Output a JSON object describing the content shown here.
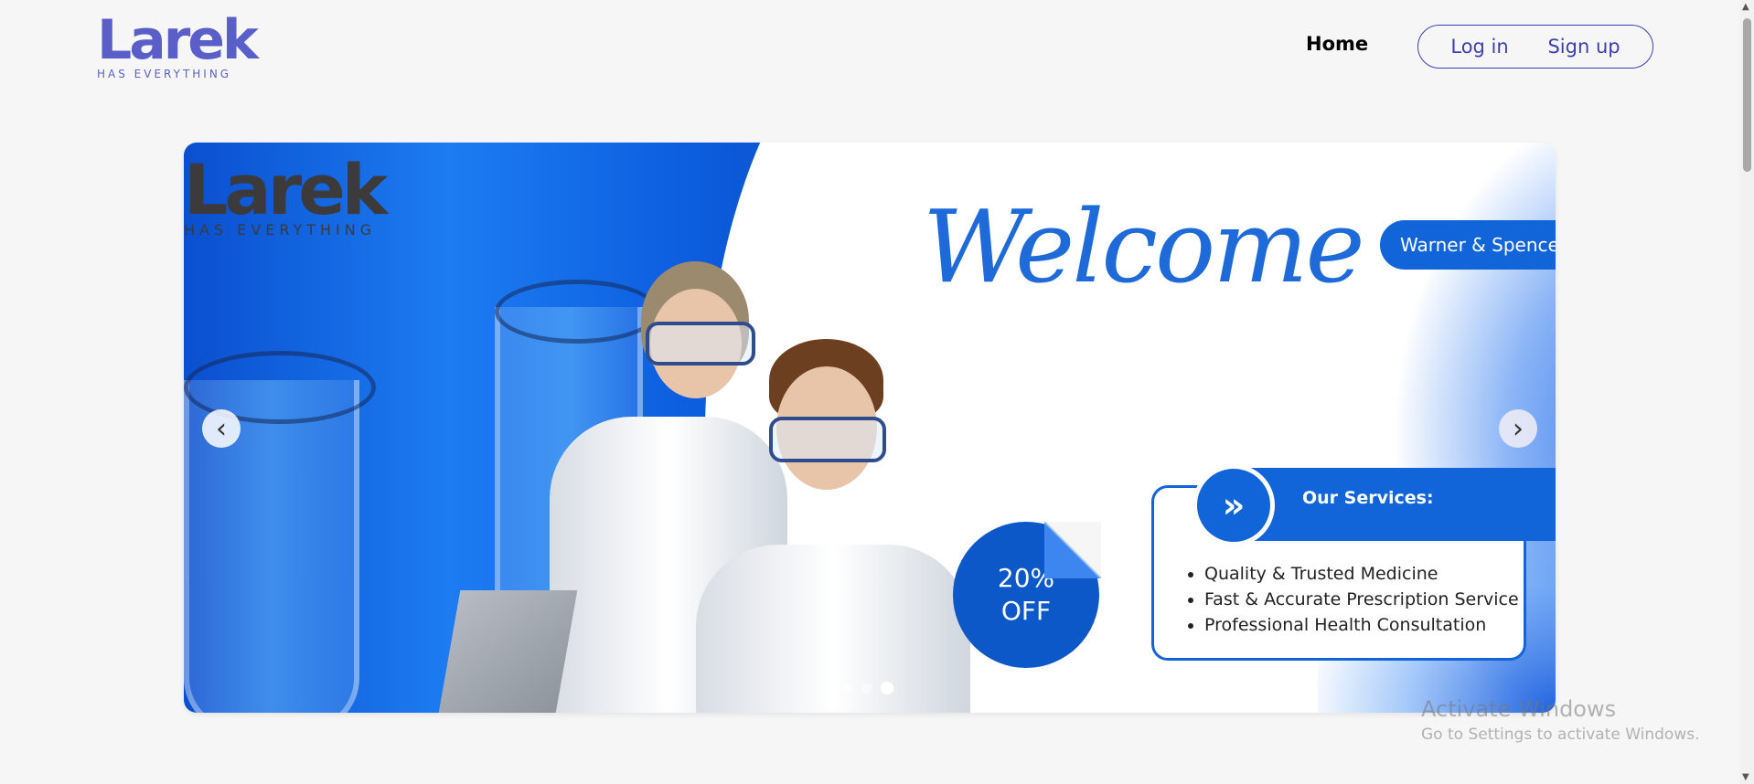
{
  "header": {
    "logo_word": "Larek",
    "logo_tagline": "HAS EVERYTHING",
    "nav_home": "Home",
    "login_label": "Log in",
    "signup_label": "Sign up"
  },
  "hero": {
    "slide_logo_word": "Larek",
    "slide_logo_tagline": "HAS EVERYTHING",
    "welcome": "Welcome",
    "brand": "Warner & Spencer",
    "offer_percent": "20%",
    "offer_word": "OFF",
    "services_icon": "»",
    "services_title": "Our Services:",
    "services": [
      "Quality & Trusted Medicine",
      "Fast & Accurate Prescription Service",
      "Professional Health Consultation"
    ],
    "prev_icon": "‹",
    "next_icon": "›",
    "total_slides": 3,
    "active_slide": 3
  },
  "watermark": {
    "line1": "Activate Windows",
    "line2": "Go to Settings to activate Windows."
  },
  "colors": {
    "brand_purple": "#5a5ec9",
    "accent_blue": "#1264d9",
    "auth_border": "#3b3fb0"
  }
}
